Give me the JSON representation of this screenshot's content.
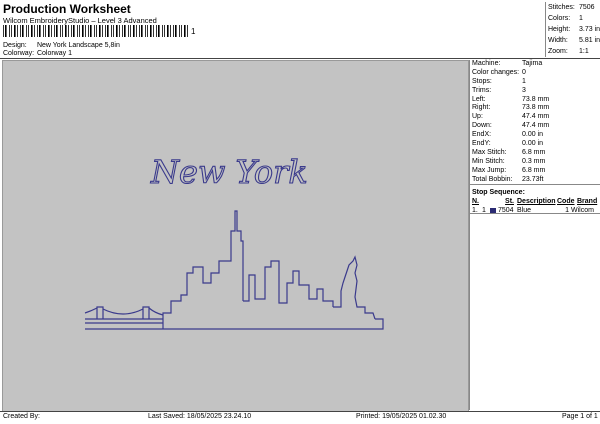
{
  "header": {
    "title": "Production Worksheet",
    "subtitle": "Wilcom EmbroideryStudio – Level 3 Advanced",
    "barcode_suffix": "1"
  },
  "info": {
    "design_label": "Design:",
    "design_value": "New York Landscape 5,8in",
    "colorway_label": "Colorway:",
    "colorway_value": "Colorway 1"
  },
  "stats": [
    {
      "label": "Stitches:",
      "value": "7506"
    },
    {
      "label": "Colors:",
      "value": "1"
    },
    {
      "label": "Height:",
      "value": "3.73 in"
    },
    {
      "label": "Width:",
      "value": "5.81 in"
    },
    {
      "label": "Zoom:",
      "value": "1:1"
    }
  ],
  "design_text": "New York",
  "machine": [
    {
      "label": "Machine:",
      "value": "Tajima"
    },
    {
      "label": "Color changes:",
      "value": "0"
    },
    {
      "label": "Stops:",
      "value": "1"
    },
    {
      "label": "Trims:",
      "value": "3"
    },
    {
      "label": "Left:",
      "value": "73.8 mm"
    },
    {
      "label": "Right:",
      "value": "73.8 mm"
    },
    {
      "label": "Up:",
      "value": "47.4 mm"
    },
    {
      "label": "Down:",
      "value": "47.4 mm"
    },
    {
      "label": "EndX:",
      "value": "0.00 in"
    },
    {
      "label": "EndY:",
      "value": "0.00 in"
    },
    {
      "label": "Max Stitch:",
      "value": "6.8 mm"
    },
    {
      "label": "Min Stitch:",
      "value": "0.3 mm"
    },
    {
      "label": "Max Jump:",
      "value": "6.8 mm"
    },
    {
      "label": "Total Bobbin:",
      "value": "23.73ft"
    }
  ],
  "stop_sequence": {
    "heading": "Stop Sequence:",
    "columns": {
      "n": "N.",
      "st": "St.",
      "description": "Description",
      "code": "Code",
      "brand": "Brand"
    },
    "rows": [
      {
        "index": "1.",
        "n": "1",
        "st": "7504",
        "description": "Blue",
        "code": "1",
        "brand": "Wilcom",
        "color": "#2b2b73"
      }
    ]
  },
  "footer": {
    "created_by": "Created By:",
    "last_saved": "Last Saved: 18/05/2025 23.24.10",
    "printed": "Printed: 19/05/2025 01.02.30",
    "page": "Page 1 of 1"
  }
}
